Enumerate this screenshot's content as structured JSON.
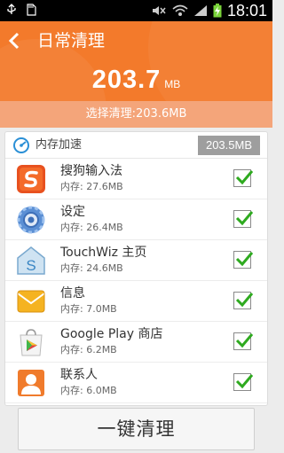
{
  "status_bar": {
    "time": "18:01"
  },
  "header": {
    "title": "日常清理",
    "size_value": "203.7",
    "size_unit": "MB",
    "selected_text": "选择清理:203.6MB"
  },
  "memory_section": {
    "title": "内存加速",
    "total": "203.5MB",
    "apps": [
      {
        "name": "搜狗输入法",
        "memory": "内存: 27.6MB",
        "checked": true,
        "icon": "sogou-input-icon"
      },
      {
        "name": "设定",
        "memory": "内存: 26.4MB",
        "checked": true,
        "icon": "settings-gear-icon"
      },
      {
        "name": "TouchWiz 主页",
        "memory": "内存: 24.6MB",
        "checked": true,
        "icon": "touchwiz-home-icon"
      },
      {
        "name": "信息",
        "memory": "内存: 7.0MB",
        "checked": true,
        "icon": "messages-envelope-icon"
      },
      {
        "name": "Google Play 商店",
        "memory": "内存: 6.2MB",
        "checked": true,
        "icon": "google-play-icon"
      },
      {
        "name": "联系人",
        "memory": "内存: 6.0MB",
        "checked": true,
        "icon": "contacts-icon"
      }
    ]
  },
  "footer": {
    "clean_button": "一键清理"
  },
  "colors": {
    "accent": "#f37a2b",
    "select_bar": "#f4a57a",
    "check_green": "#2eaa1f"
  }
}
